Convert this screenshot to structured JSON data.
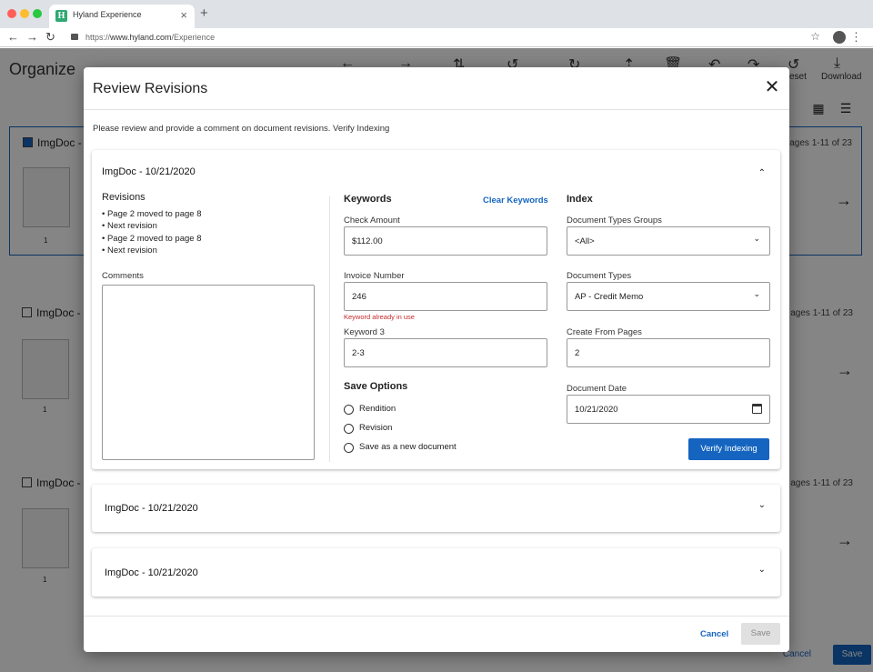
{
  "browser": {
    "tab_title": "Hyland Experience",
    "favicon_letter": "H",
    "url_scheme": "https://",
    "url_host": "www.hyland.com",
    "url_path": "/Experience",
    "back_icon": "back-arrow-icon",
    "forward_icon": "forward-arrow-icon",
    "reload_icon": "reload-icon"
  },
  "app": {
    "title": "Organize",
    "toolbar": {
      "reset_label": "eset",
      "download_label": "Download"
    },
    "docs": [
      {
        "name": "ImgDoc -",
        "pages": "ages  1-11 of 23",
        "page_num": "1",
        "checked": true
      },
      {
        "name": "ImgDoc -",
        "pages": "ages  1-11 of 23",
        "page_num": "1",
        "checked": false
      },
      {
        "name": "ImgDoc -",
        "pages": "ages  1-11 of 23",
        "page_num": "1",
        "checked": false
      }
    ],
    "footer": {
      "cancel_label": "Cancel",
      "save_label": "Save"
    }
  },
  "modal": {
    "title": "Review Revisions",
    "description": "Please review and provide a comment on document revisions. Verify Indexing",
    "expanded_card": {
      "title": "ImgDoc - 10/21/2020",
      "revisions_heading": "Revisions",
      "revisions": [
        "Page 2 moved to page 8",
        "Next revision",
        "Page 2 moved to page 8",
        "Next revision"
      ],
      "comments_label": "Comments",
      "comments_value": "",
      "keywords_heading": "Keywords",
      "clear_keywords_label": "Clear Keywords",
      "check_amount_label": "Check Amount",
      "check_amount_value": "$112.00",
      "invoice_number_label": "Invoice Number",
      "invoice_number_value": "246",
      "invoice_number_error": "Keyword already in use",
      "keyword3_label": "Keyword 3",
      "keyword3_value": "2-3",
      "save_options_heading": "Save Options",
      "save_options": [
        "Rendition",
        "Revision",
        "Save as a new document"
      ],
      "index_heading": "Index",
      "doc_type_groups_label": "Document Types Groups",
      "doc_type_groups_value": "<All>",
      "doc_types_label": "Document Types",
      "doc_types_value": "AP - Credit Memo",
      "create_from_pages_label": "Create From Pages",
      "create_from_pages_value": "2",
      "document_date_label": "Document Date",
      "document_date_value": "10/21/2020",
      "verify_indexing_label": "Verify Indexing"
    },
    "collapsed_cards": [
      {
        "title": "ImgDoc - 10/21/2020"
      },
      {
        "title": "ImgDoc - 10/21/2020"
      }
    ],
    "cancel_label": "Cancel",
    "save_label": "Save"
  },
  "colors": {
    "accent": "#1565c0",
    "error": "#c62828",
    "disabled_bg": "#e0e0e0"
  }
}
